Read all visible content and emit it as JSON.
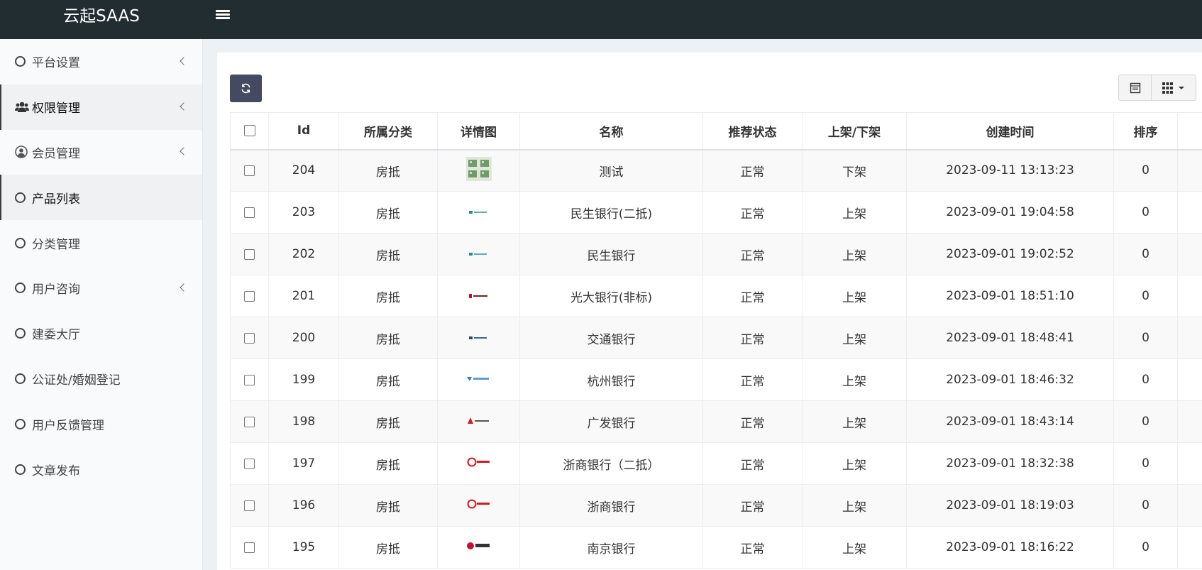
{
  "app": {
    "brand": "云起SAAS"
  },
  "sidebar": {
    "items": [
      {
        "label": "平台设置",
        "icon": "circle-icon",
        "has_submenu": true,
        "active": false
      },
      {
        "label": "权限管理",
        "icon": "users-icon",
        "has_submenu": true,
        "active": true
      },
      {
        "label": "会员管理",
        "icon": "user-circle-icon",
        "has_submenu": true,
        "active": false
      },
      {
        "label": "产品列表",
        "icon": "circle-icon",
        "has_submenu": false,
        "active": true
      },
      {
        "label": "分类管理",
        "icon": "circle-icon",
        "has_submenu": false,
        "active": false
      },
      {
        "label": "用户咨询",
        "icon": "circle-icon",
        "has_submenu": true,
        "active": false
      },
      {
        "label": "建委大厅",
        "icon": "circle-icon",
        "has_submenu": false,
        "active": false
      },
      {
        "label": "公证处/婚姻登记",
        "icon": "circle-icon",
        "has_submenu": false,
        "active": false
      },
      {
        "label": "用户反馈管理",
        "icon": "circle-icon",
        "has_submenu": false,
        "active": false
      },
      {
        "label": "文章发布",
        "icon": "circle-icon",
        "has_submenu": false,
        "active": false
      }
    ]
  },
  "toolbar": {
    "refresh_icon": "refresh-icon",
    "right_icons": [
      "list-view-icon",
      "columns-grid-icon"
    ]
  },
  "table": {
    "columns": [
      "Id",
      "所属分类",
      "详情图",
      "名称",
      "推荐状态",
      "上架/下架",
      "创建时间",
      "排序"
    ],
    "rows": [
      {
        "id": "204",
        "category": "房抵",
        "thumb": "house-image",
        "name": "测试",
        "recommend": "正常",
        "shelf": "下架",
        "created": "2023-09-11 13:13:23",
        "sort": "0"
      },
      {
        "id": "203",
        "category": "房抵",
        "thumb": "minsheng-logo",
        "name": "民生银行(二抵)",
        "recommend": "正常",
        "shelf": "上架",
        "created": "2023-09-01 19:04:58",
        "sort": "0"
      },
      {
        "id": "202",
        "category": "房抵",
        "thumb": "minsheng-logo",
        "name": "民生银行",
        "recommend": "正常",
        "shelf": "上架",
        "created": "2023-09-01 19:02:52",
        "sort": "0"
      },
      {
        "id": "201",
        "category": "房抵",
        "thumb": "everbright-logo",
        "name": "光大银行(非标)",
        "recommend": "正常",
        "shelf": "上架",
        "created": "2023-09-01 18:51:10",
        "sort": "0"
      },
      {
        "id": "200",
        "category": "房抵",
        "thumb": "bocom-logo",
        "name": "交通银行",
        "recommend": "正常",
        "shelf": "上架",
        "created": "2023-09-01 18:48:41",
        "sort": "0"
      },
      {
        "id": "199",
        "category": "房抵",
        "thumb": "hangzhou-logo",
        "name": "杭州银行",
        "recommend": "正常",
        "shelf": "上架",
        "created": "2023-09-01 18:46:32",
        "sort": "0"
      },
      {
        "id": "198",
        "category": "房抵",
        "thumb": "cgb-logo",
        "name": "广发银行",
        "recommend": "正常",
        "shelf": "上架",
        "created": "2023-09-01 18:43:14",
        "sort": "0"
      },
      {
        "id": "197",
        "category": "房抵",
        "thumb": "czbank-logo",
        "name": "浙商银行（二抵）",
        "recommend": "正常",
        "shelf": "上架",
        "created": "2023-09-01 18:32:38",
        "sort": "0"
      },
      {
        "id": "196",
        "category": "房抵",
        "thumb": "czbank-logo",
        "name": "浙商银行",
        "recommend": "正常",
        "shelf": "上架",
        "created": "2023-09-01 18:19:03",
        "sort": "0"
      },
      {
        "id": "195",
        "category": "房抵",
        "thumb": "nanjing-logo",
        "name": "南京银行",
        "recommend": "正常",
        "shelf": "上架",
        "created": "2023-09-01 18:16:22",
        "sort": "0"
      }
    ]
  },
  "colors": {
    "topbar": "#222d32",
    "refresh_button": "#444a61",
    "sidebar_bg": "#f9fafc",
    "row_stripe": "#f9f9f9"
  }
}
